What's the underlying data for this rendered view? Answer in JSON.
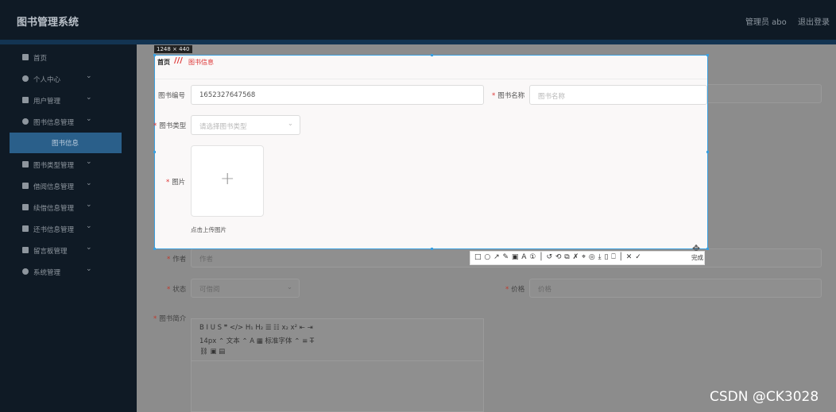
{
  "header": {
    "title": "图书管理系统",
    "admin_label": "管理员 abo",
    "logout": "退出登录"
  },
  "sidebar": {
    "items": [
      {
        "label": "首页",
        "icon": "home-icon",
        "chev": ""
      },
      {
        "label": "个人中心",
        "icon": "user-icon",
        "chev": "⌄"
      },
      {
        "label": "用户管理",
        "icon": "user-manage-icon",
        "chev": "⌄"
      },
      {
        "label": "图书信息管理",
        "icon": "book-icon",
        "chev": "⌄"
      },
      {
        "label": "图书信息",
        "icon": "",
        "chev": ""
      },
      {
        "label": "图书类型管理",
        "icon": "grid-icon",
        "chev": "⌄"
      },
      {
        "label": "借阅信息管理",
        "icon": "list-icon",
        "chev": "⌄"
      },
      {
        "label": "续借信息管理",
        "icon": "grid-icon",
        "chev": "⌄"
      },
      {
        "label": "还书信息管理",
        "icon": "chat-icon",
        "chev": "⌄"
      },
      {
        "label": "留言板管理",
        "icon": "message-icon",
        "chev": "⌄"
      },
      {
        "label": "系统管理",
        "icon": "settings-icon",
        "chev": "⌄"
      }
    ]
  },
  "form": {
    "author_label": "作者",
    "author_placeholder": "作者",
    "status_label": "状态",
    "status_value": "可借阅",
    "price_label": "价格",
    "price_placeholder": "价格",
    "desc_label": "图书简介",
    "editor_row1": "B   I   U   S      ❞   </>     H₁  H₂     ☰   ☷      x₂  x²     ⇤   ⇥",
    "editor_row2": "14px          ⌃       文本          ⌃      A   ▦      标准字体          ⌃      ≡      T̶",
    "editor_row3": "⛓   ▣   ▤"
  },
  "capture": {
    "size_tag": "1248 × 440",
    "crumb_home": "首页",
    "crumb_sep": "///",
    "crumb_current": "图书信息",
    "book_no_label": "图书编号",
    "book_no_value": "1652327647568",
    "book_name_label": "图书名称",
    "book_name_placeholder": "图书名称",
    "book_type_label": "图书类型",
    "book_type_placeholder": "请选择图书类型",
    "image_label": "图片",
    "upload_hint": "点击上传图片"
  },
  "toolbar": {
    "icons": "□  ○  ↗  ✎  ▣  A  ①  │ ↺  ⟲  ⧉  ✗  ⌖  ◎  ⤓  ▯  ⎕  │ ✕  ✓",
    "done": "完成"
  },
  "watermark": "CSDN @CK3028"
}
